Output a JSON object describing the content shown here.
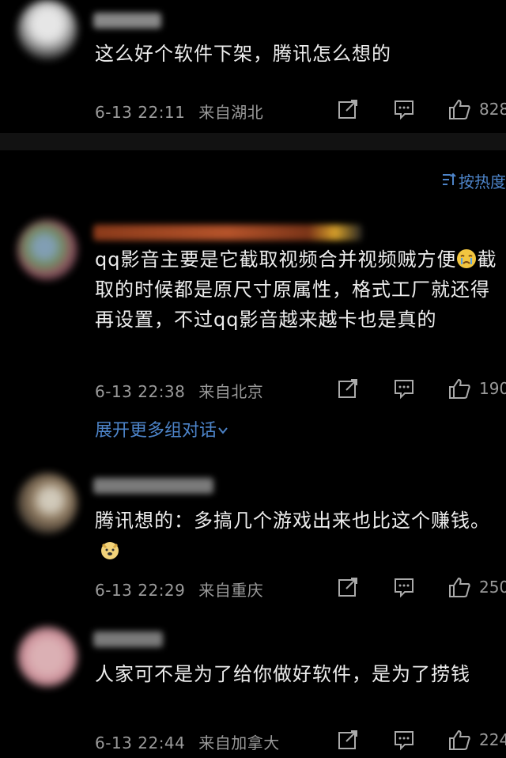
{
  "sort_label": "按热度",
  "expand_label": "展开更多组对话",
  "comments": [
    {
      "text": "这么好个软件下架，腾讯怎么想的",
      "time": "6-13 22:11",
      "location": "来自湖北",
      "likes": "828"
    },
    {
      "text_parts": [
        "qq影音主要是它截取视频合并视频贼方便",
        "截取的时候都是原尺寸原属性，格式工厂就还得再设置，不过qq影音越来越卡也是真的"
      ],
      "emoji": "crying-face-emoji",
      "time": "6-13 22:38",
      "location": "来自北京",
      "likes": "190"
    },
    {
      "text_parts": [
        "腾讯想的：多搞几个游戏出来也比这个赚钱。"
      ],
      "emoji": "doge-emoji",
      "time": "6-13 22:29",
      "location": "来自重庆",
      "likes": "250"
    },
    {
      "text": "人家可不是为了给你做好软件，是为了捞钱",
      "time": "6-13 22:44",
      "location": "来自加拿大",
      "likes": "224"
    }
  ],
  "colors": {
    "background": "#000000",
    "text": "#ededed",
    "meta": "#9a9a9a",
    "link": "#4d84c9"
  }
}
